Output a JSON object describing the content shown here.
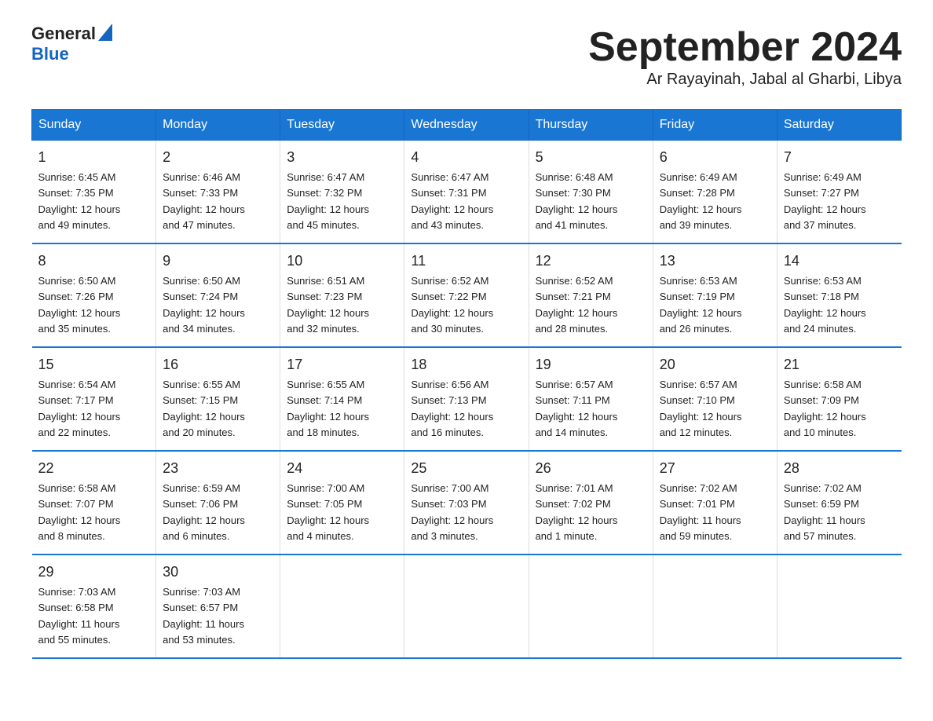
{
  "header": {
    "logo_general": "General",
    "logo_blue": "Blue",
    "title": "September 2024",
    "location": "Ar Rayayinah, Jabal al Gharbi, Libya"
  },
  "days_of_week": [
    "Sunday",
    "Monday",
    "Tuesday",
    "Wednesday",
    "Thursday",
    "Friday",
    "Saturday"
  ],
  "weeks": [
    [
      {
        "day": "1",
        "sunrise": "6:45 AM",
        "sunset": "7:35 PM",
        "daylight": "12 hours and 49 minutes."
      },
      {
        "day": "2",
        "sunrise": "6:46 AM",
        "sunset": "7:33 PM",
        "daylight": "12 hours and 47 minutes."
      },
      {
        "day": "3",
        "sunrise": "6:47 AM",
        "sunset": "7:32 PM",
        "daylight": "12 hours and 45 minutes."
      },
      {
        "day": "4",
        "sunrise": "6:47 AM",
        "sunset": "7:31 PM",
        "daylight": "12 hours and 43 minutes."
      },
      {
        "day": "5",
        "sunrise": "6:48 AM",
        "sunset": "7:30 PM",
        "daylight": "12 hours and 41 minutes."
      },
      {
        "day": "6",
        "sunrise": "6:49 AM",
        "sunset": "7:28 PM",
        "daylight": "12 hours and 39 minutes."
      },
      {
        "day": "7",
        "sunrise": "6:49 AM",
        "sunset": "7:27 PM",
        "daylight": "12 hours and 37 minutes."
      }
    ],
    [
      {
        "day": "8",
        "sunrise": "6:50 AM",
        "sunset": "7:26 PM",
        "daylight": "12 hours and 35 minutes."
      },
      {
        "day": "9",
        "sunrise": "6:50 AM",
        "sunset": "7:24 PM",
        "daylight": "12 hours and 34 minutes."
      },
      {
        "day": "10",
        "sunrise": "6:51 AM",
        "sunset": "7:23 PM",
        "daylight": "12 hours and 32 minutes."
      },
      {
        "day": "11",
        "sunrise": "6:52 AM",
        "sunset": "7:22 PM",
        "daylight": "12 hours and 30 minutes."
      },
      {
        "day": "12",
        "sunrise": "6:52 AM",
        "sunset": "7:21 PM",
        "daylight": "12 hours and 28 minutes."
      },
      {
        "day": "13",
        "sunrise": "6:53 AM",
        "sunset": "7:19 PM",
        "daylight": "12 hours and 26 minutes."
      },
      {
        "day": "14",
        "sunrise": "6:53 AM",
        "sunset": "7:18 PM",
        "daylight": "12 hours and 24 minutes."
      }
    ],
    [
      {
        "day": "15",
        "sunrise": "6:54 AM",
        "sunset": "7:17 PM",
        "daylight": "12 hours and 22 minutes."
      },
      {
        "day": "16",
        "sunrise": "6:55 AM",
        "sunset": "7:15 PM",
        "daylight": "12 hours and 20 minutes."
      },
      {
        "day": "17",
        "sunrise": "6:55 AM",
        "sunset": "7:14 PM",
        "daylight": "12 hours and 18 minutes."
      },
      {
        "day": "18",
        "sunrise": "6:56 AM",
        "sunset": "7:13 PM",
        "daylight": "12 hours and 16 minutes."
      },
      {
        "day": "19",
        "sunrise": "6:57 AM",
        "sunset": "7:11 PM",
        "daylight": "12 hours and 14 minutes."
      },
      {
        "day": "20",
        "sunrise": "6:57 AM",
        "sunset": "7:10 PM",
        "daylight": "12 hours and 12 minutes."
      },
      {
        "day": "21",
        "sunrise": "6:58 AM",
        "sunset": "7:09 PM",
        "daylight": "12 hours and 10 minutes."
      }
    ],
    [
      {
        "day": "22",
        "sunrise": "6:58 AM",
        "sunset": "7:07 PM",
        "daylight": "12 hours and 8 minutes."
      },
      {
        "day": "23",
        "sunrise": "6:59 AM",
        "sunset": "7:06 PM",
        "daylight": "12 hours and 6 minutes."
      },
      {
        "day": "24",
        "sunrise": "7:00 AM",
        "sunset": "7:05 PM",
        "daylight": "12 hours and 4 minutes."
      },
      {
        "day": "25",
        "sunrise": "7:00 AM",
        "sunset": "7:03 PM",
        "daylight": "12 hours and 3 minutes."
      },
      {
        "day": "26",
        "sunrise": "7:01 AM",
        "sunset": "7:02 PM",
        "daylight": "12 hours and 1 minute."
      },
      {
        "day": "27",
        "sunrise": "7:02 AM",
        "sunset": "7:01 PM",
        "daylight": "11 hours and 59 minutes."
      },
      {
        "day": "28",
        "sunrise": "7:02 AM",
        "sunset": "6:59 PM",
        "daylight": "11 hours and 57 minutes."
      }
    ],
    [
      {
        "day": "29",
        "sunrise": "7:03 AM",
        "sunset": "6:58 PM",
        "daylight": "11 hours and 55 minutes."
      },
      {
        "day": "30",
        "sunrise": "7:03 AM",
        "sunset": "6:57 PM",
        "daylight": "11 hours and 53 minutes."
      },
      null,
      null,
      null,
      null,
      null
    ]
  ],
  "labels": {
    "sunrise": "Sunrise:",
    "sunset": "Sunset:",
    "daylight": "Daylight:"
  }
}
